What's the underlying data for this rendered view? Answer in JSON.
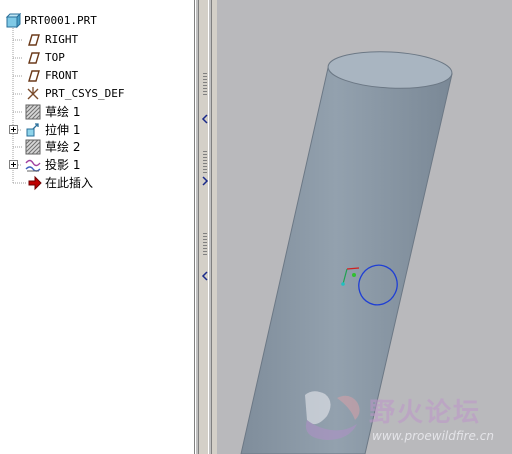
{
  "model_tree": {
    "root": {
      "label": "PRT0001.PRT",
      "icon": "part-icon"
    },
    "items": [
      {
        "label": "RIGHT",
        "icon": "datum-plane-icon",
        "expandable": false
      },
      {
        "label": "TOP",
        "icon": "datum-plane-icon",
        "expandable": false
      },
      {
        "label": "FRONT",
        "icon": "datum-plane-icon",
        "expandable": false
      },
      {
        "label": "PRT_CSYS_DEF",
        "icon": "coordinate-system-icon",
        "expandable": false
      },
      {
        "label": "草绘 1",
        "icon": "sketch-icon",
        "expandable": false
      },
      {
        "label": "拉伸 1",
        "icon": "extrude-icon",
        "expandable": true
      },
      {
        "label": "草绘 2",
        "icon": "sketch-icon",
        "expandable": false
      },
      {
        "label": "投影 1",
        "icon": "projected-curve-icon",
        "expandable": true
      },
      {
        "label": "在此插入",
        "icon": "insert-here-arrow-icon",
        "expandable": false
      }
    ]
  },
  "watermark": {
    "text": "野火论坛",
    "url": "www.proewildfire.cn",
    "logo": "wildfire-logo-icon"
  },
  "colors": {
    "viewport_background": "#b9b9bc",
    "cylinder_body": "#8c9aa8",
    "cylinder_top": "#a8b4c0",
    "sketch_curve": "#1f3fd4",
    "insert_arrow": "#c00000"
  }
}
